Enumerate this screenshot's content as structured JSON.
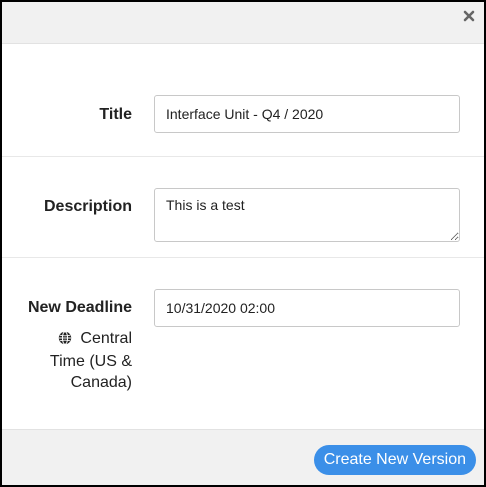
{
  "dialog": {
    "close_icon": "close-icon",
    "fields": {
      "title": {
        "label": "Title",
        "value": "Interface Unit - Q4 / 2020"
      },
      "description": {
        "label": "Description",
        "value": "This is a test"
      },
      "deadline": {
        "label": "New Deadline",
        "value": "10/31/2020 02:00",
        "timezone_icon": "globe-icon",
        "timezone": "Central Time (US & Canada)"
      }
    },
    "footer": {
      "submit_label": "Create New Version"
    }
  },
  "colors": {
    "header_bg": "#f1f1f1",
    "primary_button": "#3b8fe8",
    "border": "#000000"
  }
}
